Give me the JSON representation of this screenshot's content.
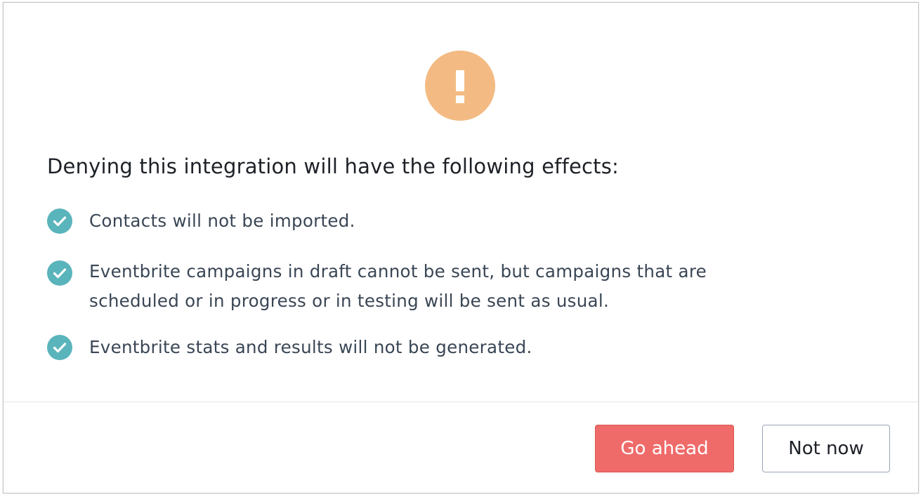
{
  "dialog": {
    "heading": "Denying this integration will have the following effects:",
    "effects": [
      "Contacts will not be imported.",
      "Eventbrite campaigns in draft cannot be sent, but campaigns that are scheduled or in progress or in testing will be sent as usual.",
      "Eventbrite stats and results will not be generated."
    ],
    "buttons": {
      "confirm_label": "Go ahead",
      "cancel_label": "Not now"
    },
    "icons": {
      "warning": "exclamation-circle-icon",
      "effect": "check-circle-icon"
    },
    "colors": {
      "warning": "#f3bb83",
      "check": "#5ab4bb",
      "confirm": "#ef6b6a",
      "cancel_border": "#9aa5b8"
    }
  }
}
